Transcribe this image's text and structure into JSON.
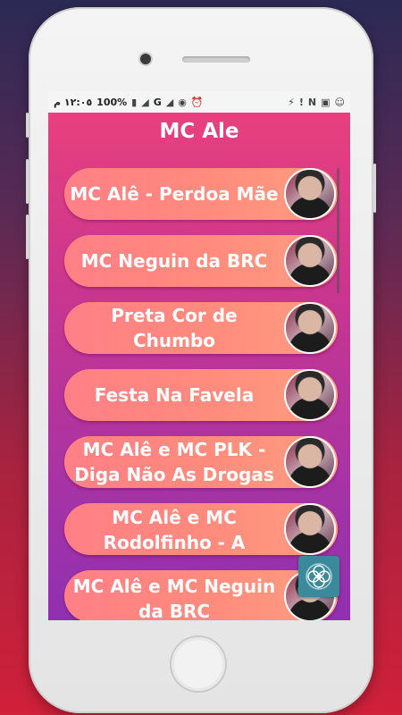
{
  "status_bar": {
    "time": "١٢:٠٥ م",
    "battery": "100%",
    "network": "G",
    "icons": [
      "battery-icon",
      "signal-icon",
      "wifi-icon",
      "alarm-icon",
      "flash-icon",
      "notification-icon",
      "nfc-icon",
      "image-icon",
      "chat-icon"
    ]
  },
  "app": {
    "title": "MC Ale",
    "items": [
      {
        "label": "MC Alê - Perdoa Mãe"
      },
      {
        "label": "MC Neguin da BRC"
      },
      {
        "label": "Preta Cor de Chumbo"
      },
      {
        "label": "Festa Na Favela"
      },
      {
        "label": "MC Alê e MC PLK - Diga Não As Drogas"
      },
      {
        "label": "MC Alê e MC Rodolfinho - A"
      },
      {
        "label": "MC Alê e MC Neguin da BRC"
      }
    ],
    "fab_icon": "flower-icon"
  }
}
